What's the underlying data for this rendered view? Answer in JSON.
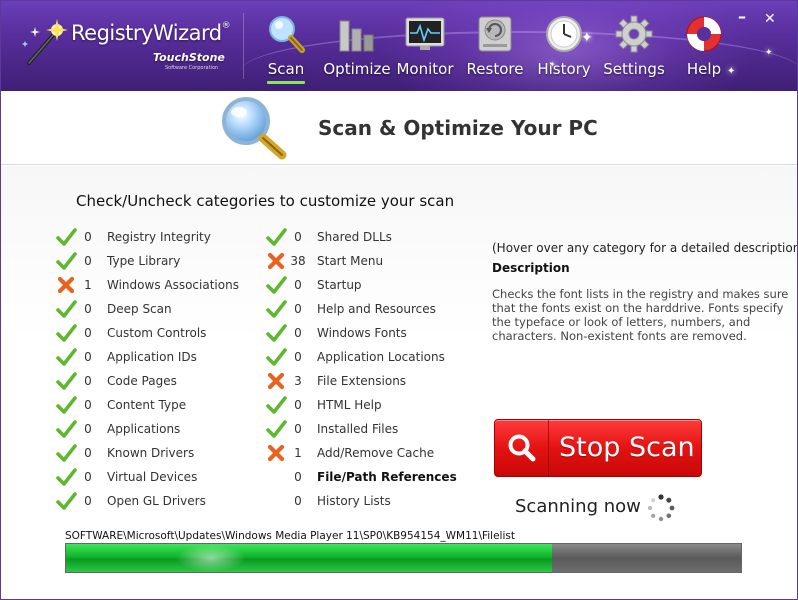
{
  "app": {
    "brand_name": "RegistryWizard",
    "brand_mark": "®",
    "vendor": "TouchStone",
    "vendor_tagline": "Software Corporation"
  },
  "nav": {
    "items": [
      {
        "label": "Scan",
        "icon": "magnifier-icon",
        "active": true
      },
      {
        "label": "Optimize",
        "icon": "bar-chart-icon",
        "active": false
      },
      {
        "label": "Monitor",
        "icon": "monitor-icon",
        "active": false
      },
      {
        "label": "Restore",
        "icon": "hard-drive-icon",
        "active": false
      },
      {
        "label": "History",
        "icon": "clock-icon",
        "active": false
      },
      {
        "label": "Settings",
        "icon": "gear-icon",
        "active": false
      },
      {
        "label": "Help",
        "icon": "lifebuoy-icon",
        "active": false
      }
    ]
  },
  "window_controls": {
    "minimize": "–",
    "close": "✕"
  },
  "page": {
    "title": "Scan & Optimize Your PC",
    "instruction": "Check/Uncheck categories to customize your  scan"
  },
  "categories": {
    "left": [
      {
        "name": "Registry Integrity",
        "count": "0",
        "status": "ok"
      },
      {
        "name": "Type Library",
        "count": "0",
        "status": "ok"
      },
      {
        "name": "Windows Associations",
        "count": "1",
        "status": "issue"
      },
      {
        "name": "Deep Scan",
        "count": "0",
        "status": "ok"
      },
      {
        "name": "Custom Controls",
        "count": "0",
        "status": "ok"
      },
      {
        "name": "Application IDs",
        "count": "0",
        "status": "ok"
      },
      {
        "name": "Code Pages",
        "count": "0",
        "status": "ok"
      },
      {
        "name": "Content Type",
        "count": "0",
        "status": "ok"
      },
      {
        "name": "Applications",
        "count": "0",
        "status": "ok"
      },
      {
        "name": "Known Drivers",
        "count": "0",
        "status": "ok"
      },
      {
        "name": "Virtual Devices",
        "count": "0",
        "status": "ok"
      },
      {
        "name": "Open GL Drivers",
        "count": "0",
        "status": "ok"
      }
    ],
    "right": [
      {
        "name": "Shared DLLs",
        "count": "0",
        "status": "ok"
      },
      {
        "name": "Start Menu",
        "count": "38",
        "status": "issue"
      },
      {
        "name": "Startup",
        "count": "0",
        "status": "ok"
      },
      {
        "name": "Help and Resources",
        "count": "0",
        "status": "ok"
      },
      {
        "name": "Windows Fonts",
        "count": "0",
        "status": "ok"
      },
      {
        "name": "Application Locations",
        "count": "0",
        "status": "ok"
      },
      {
        "name": "File Extensions",
        "count": "3",
        "status": "issue"
      },
      {
        "name": "HTML Help",
        "count": "0",
        "status": "ok"
      },
      {
        "name": "Installed Files",
        "count": "0",
        "status": "ok"
      },
      {
        "name": "Add/Remove Cache",
        "count": "1",
        "status": "issue"
      },
      {
        "name": "File/Path References",
        "count": "0",
        "status": "scanning"
      },
      {
        "name": "History Lists",
        "count": "0",
        "status": "pending"
      }
    ]
  },
  "description": {
    "hint": "(Hover over any category for a detailed description)",
    "title": "Description",
    "text": "Checks the font lists in the registry and makes sure that the fonts exist on the harddrive. Fonts specify the typeface or look of letters, numbers, and characters. Non-existent fonts are removed."
  },
  "scan": {
    "stop_label": "Stop Scan",
    "status_text": "Scanning now",
    "current_path": "SOFTWARE\\Microsoft\\Updates\\Windows Media Player 11\\SP0\\KB954154_WM11\\Filelist",
    "progress": 0.72
  },
  "colors": {
    "header": "#5a2f9e",
    "ok": "#5cb82c",
    "issue": "#e8641e",
    "stop_button": "#e51212",
    "progress_fill": "#0fb52b"
  }
}
